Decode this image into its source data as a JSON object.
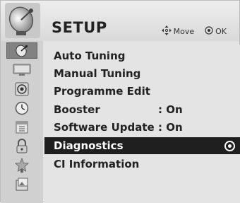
{
  "header": {
    "title": "SETUP",
    "logo_icon": "satellite-dish-icon",
    "hint_move_icon": "four-way-arrow-icon",
    "hint_move": "Move",
    "hint_ok_icon": "ok-button-icon",
    "hint_ok": "OK"
  },
  "sidebar": {
    "icons": [
      "setup-dish-icon",
      "picture-screen-icon",
      "audio-speaker-icon",
      "time-clock-icon",
      "option-calendar-icon",
      "lock-icon",
      "input-star-icon",
      "usb-photo-icon"
    ],
    "active_index": 0
  },
  "menu": {
    "items": [
      {
        "label": "Auto Tuning",
        "value": ""
      },
      {
        "label": "Manual Tuning",
        "value": ""
      },
      {
        "label": "Programme Edit",
        "value": ""
      },
      {
        "label": "Booster",
        "value": ": On"
      },
      {
        "label": "Software Update",
        "value": ": On"
      },
      {
        "label": "Diagnostics",
        "value": ""
      },
      {
        "label": "CI Information",
        "value": ""
      }
    ],
    "selected_index": 5
  },
  "colors": {
    "background": "#e4e4e4",
    "highlight": "#1f1f1f",
    "sidebar": "#d0d0d0",
    "active_icon": "#828282"
  }
}
